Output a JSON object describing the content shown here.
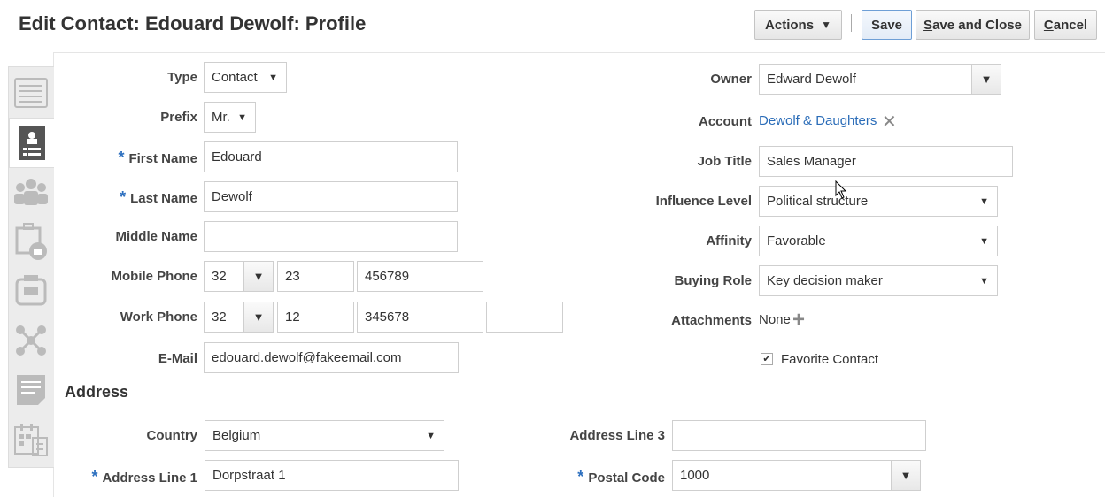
{
  "header": {
    "title": "Edit Contact: Edouard Dewolf: Profile",
    "actions_label": "Actions",
    "save_label": "Save",
    "save_close_first": "S",
    "save_close_rest": "ave and Close",
    "cancel_first": "C",
    "cancel_rest": "ancel"
  },
  "sidebar": {
    "tabs": [
      "summary-icon",
      "profile-icon",
      "team-icon",
      "opportunity-icon",
      "notes-icon",
      "relationships-icon",
      "documents-icon",
      "calendar-icon"
    ]
  },
  "form": {
    "type": {
      "label": "Type",
      "value": "Contact"
    },
    "prefix": {
      "label": "Prefix",
      "value": "Mr."
    },
    "first_name": {
      "label": "First Name",
      "value": "Edouard"
    },
    "last_name": {
      "label": "Last Name",
      "value": "Dewolf"
    },
    "middle_name": {
      "label": "Middle Name",
      "value": ""
    },
    "mobile_phone": {
      "label": "Mobile Phone",
      "country": "32",
      "area": "23",
      "number": "456789"
    },
    "work_phone": {
      "label": "Work Phone",
      "country": "32",
      "area": "12",
      "number": "345678",
      "ext": ""
    },
    "email": {
      "label": "E-Mail",
      "value": "edouard.dewolf@fakeemail.com"
    },
    "owner": {
      "label": "Owner",
      "value": "Edward Dewolf"
    },
    "account": {
      "label": "Account",
      "value": "Dewolf & Daughters"
    },
    "job_title": {
      "label": "Job Title",
      "value": "Sales Manager"
    },
    "influence_level": {
      "label": "Influence Level",
      "value": "Political structure"
    },
    "affinity": {
      "label": "Affinity",
      "value": "Favorable"
    },
    "buying_role": {
      "label": "Buying Role",
      "value": "Key decision maker"
    },
    "attachments": {
      "label": "Attachments",
      "value": "None"
    },
    "favorite": {
      "label": "Favorite Contact",
      "checked": true
    }
  },
  "address": {
    "heading": "Address",
    "country": {
      "label": "Country",
      "value": "Belgium"
    },
    "line1": {
      "label": "Address Line 1",
      "value": "Dorpstraat 1"
    },
    "line3": {
      "label": "Address Line 3",
      "value": ""
    },
    "postal_code": {
      "label": "Postal Code",
      "value": "1000"
    }
  },
  "colors": {
    "link": "#2a6cb8",
    "required": "#2c6fbf"
  }
}
